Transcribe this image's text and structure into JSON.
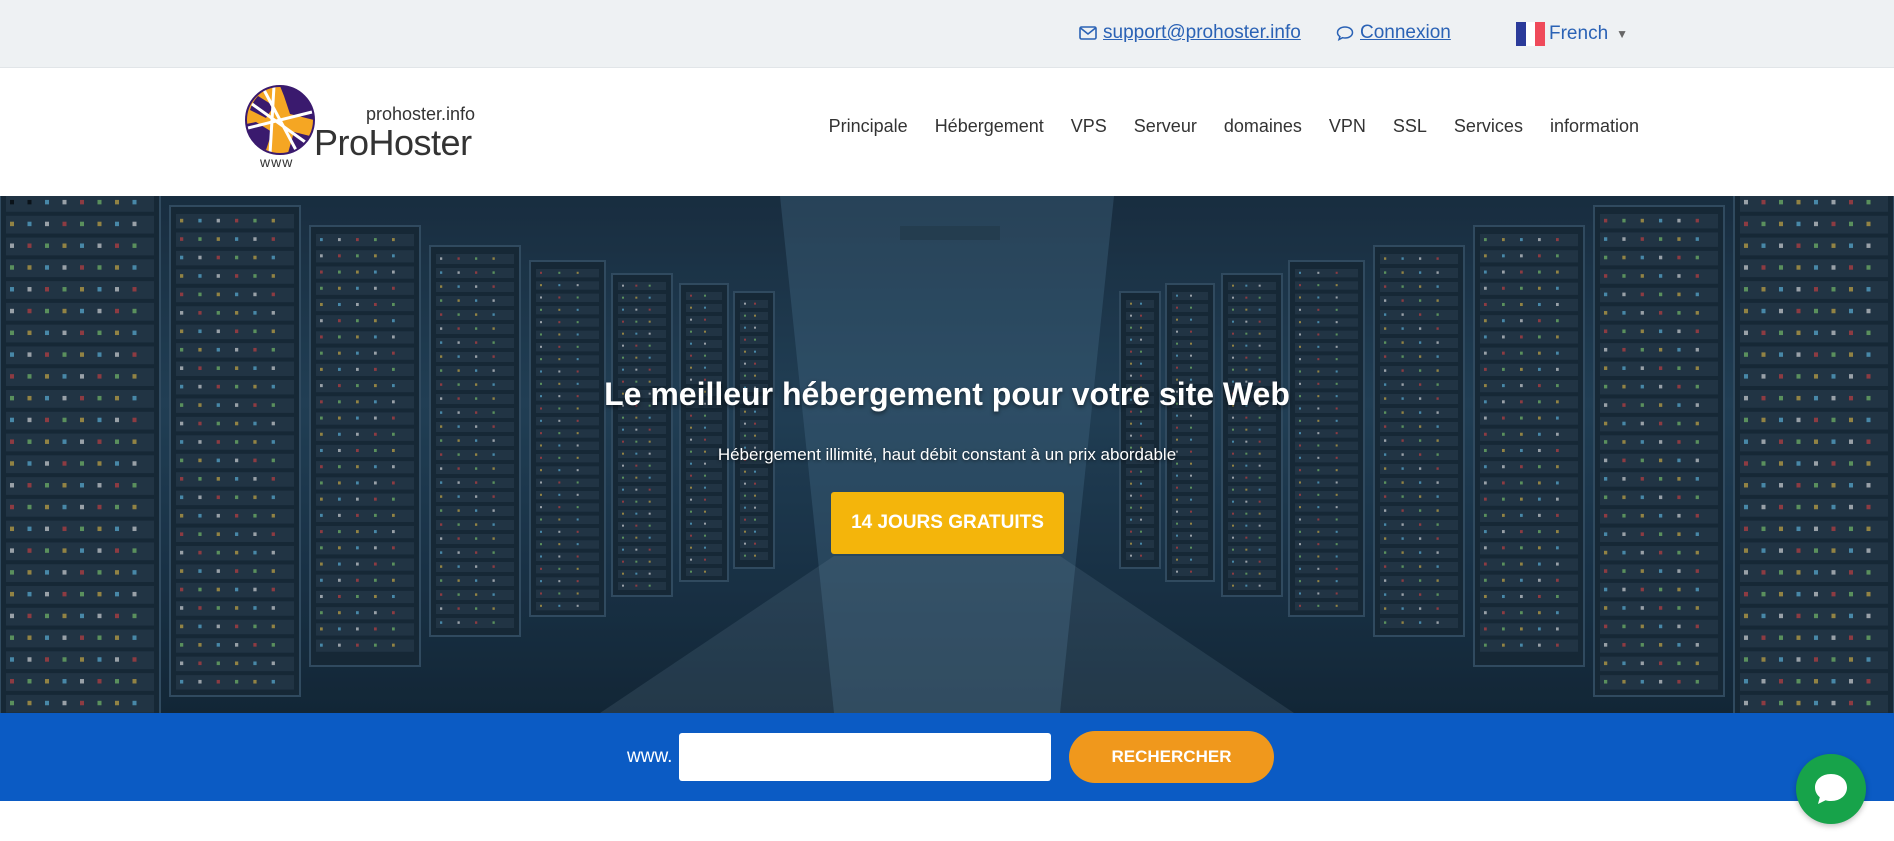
{
  "topbar": {
    "email": "support@prohoster.info ",
    "login": "Connexion",
    "language": "French"
  },
  "logo": {
    "domain": "prohoster.info",
    "name": "ProHoster",
    "www": "www"
  },
  "nav": {
    "items": [
      {
        "label": "Principale"
      },
      {
        "label": "Hébergement"
      },
      {
        "label": "VPS"
      },
      {
        "label": "Serveur"
      },
      {
        "label": "domaines"
      },
      {
        "label": "VPN"
      },
      {
        "label": "SSL"
      },
      {
        "label": "Services"
      },
      {
        "label": "information"
      }
    ]
  },
  "hero": {
    "title": "Le meilleur hébergement pour votre site Web",
    "subtitle": "Hébergement illimité, haut débit constant à un prix abordable",
    "cta": "14 JOURS GRATUITS"
  },
  "search": {
    "prefix": "www.",
    "input_value": "",
    "button": "RECHERCHER"
  },
  "colors": {
    "link": "#2a62b5",
    "cta_yellow": "#f4b50b",
    "search_band": "#0b5bc4",
    "search_button": "#f0981c",
    "chat_green": "#17a34a"
  },
  "icons": {
    "email": "envelope-icon",
    "login": "speech-bubble-icon",
    "language": "france-flag-icon",
    "chat": "chat-bubble-icon"
  }
}
